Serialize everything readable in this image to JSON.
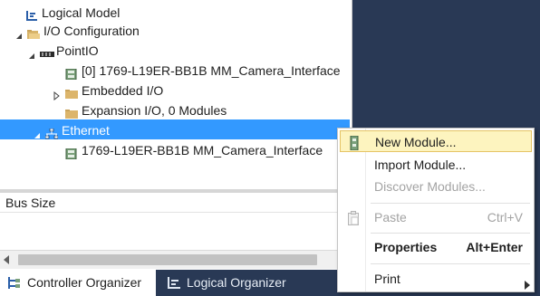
{
  "tree": {
    "items": [
      {
        "label": "Logical Model"
      },
      {
        "label": "I/O Configuration"
      },
      {
        "label": "PointIO"
      },
      {
        "label": "[0] 1769-L19ER-BB1B MM_Camera_Interface"
      },
      {
        "label": "Embedded I/O"
      },
      {
        "label": "Expansion I/O, 0 Modules"
      },
      {
        "label": "Ethernet"
      },
      {
        "label": "1769-L19ER-BB1B MM_Camera_Interface"
      }
    ]
  },
  "properties": {
    "header": "Bus Size"
  },
  "tabs": [
    {
      "label": "Controller Organizer"
    },
    {
      "label": "Logical Organizer"
    }
  ],
  "context_menu": {
    "items": [
      {
        "label": "New Module...",
        "shortcut": ""
      },
      {
        "label": "Import Module...",
        "shortcut": ""
      },
      {
        "label": "Discover Modules...",
        "shortcut": ""
      },
      {
        "label": "Paste",
        "shortcut": "Ctrl+V"
      },
      {
        "label": "Properties",
        "shortcut": "Alt+Enter"
      },
      {
        "label": "Print",
        "shortcut": ""
      }
    ]
  },
  "colors": {
    "selection": "#3399ff",
    "menu_highlight": "#fdf4bf",
    "tab_bar": "#293955",
    "disabled_text": "#a3a3a3"
  }
}
